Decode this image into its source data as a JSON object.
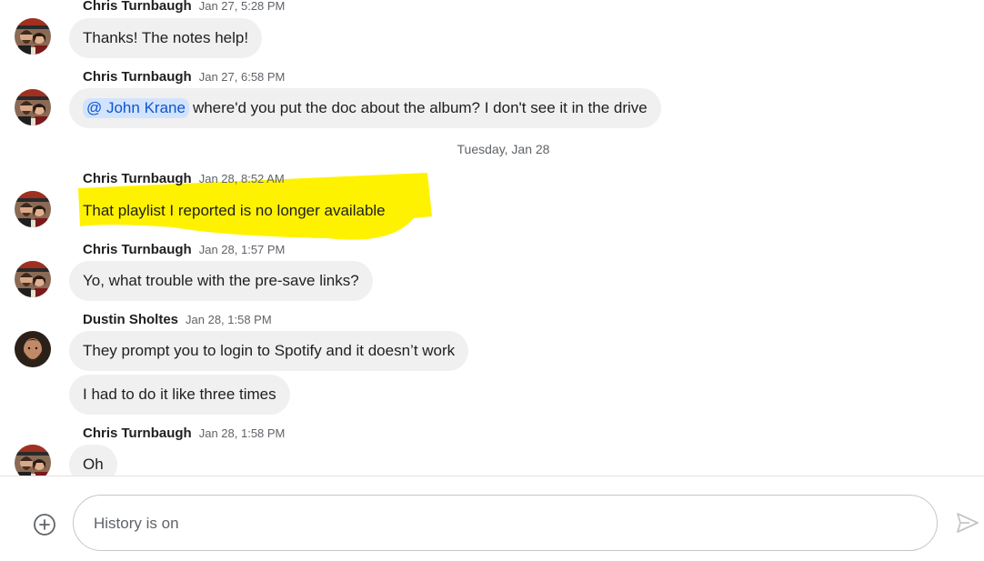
{
  "messages": [
    {
      "sender": "Chris Turnbaugh",
      "time": "Jan 27, 5:28 PM",
      "bubbles": [
        "Thanks! The notes help!"
      ]
    },
    {
      "sender": "Chris Turnbaugh",
      "time": "Jan 27, 6:58 PM",
      "bubbles": [
        {
          "mention": "@ John Krane",
          "text": "where'd you put the doc about the album? I don't see it in the drive"
        }
      ]
    },
    {
      "sender": "Chris Turnbaugh",
      "time": "Jan 28, 8:52 AM",
      "bubbles": [
        "That playlist I reported is no longer available"
      ],
      "highlighted": true
    },
    {
      "sender": "Chris Turnbaugh",
      "time": "Jan 28, 1:57 PM",
      "bubbles": [
        "Yo, what trouble with the pre-save links?"
      ]
    },
    {
      "sender": "Dustin Sholtes",
      "time": "Jan 28, 1:58 PM",
      "bubbles": [
        "They prompt you to login to Spotify and it doesn’t work",
        "I had to do it like three times"
      ]
    },
    {
      "sender": "Chris Turnbaugh",
      "time": "Jan 28, 1:58 PM",
      "bubbles": [
        "Oh"
      ]
    }
  ],
  "day_divider": "Tuesday, Jan 28",
  "composer": {
    "placeholder": "History is on",
    "add_icon": "add-circle-icon",
    "send_icon": "send-icon"
  },
  "colors": {
    "bubble": "#f0f0f0",
    "mention_bg": "#d3e3fd",
    "highlight": "#fff200",
    "send_disabled": "#c4c7c5"
  }
}
